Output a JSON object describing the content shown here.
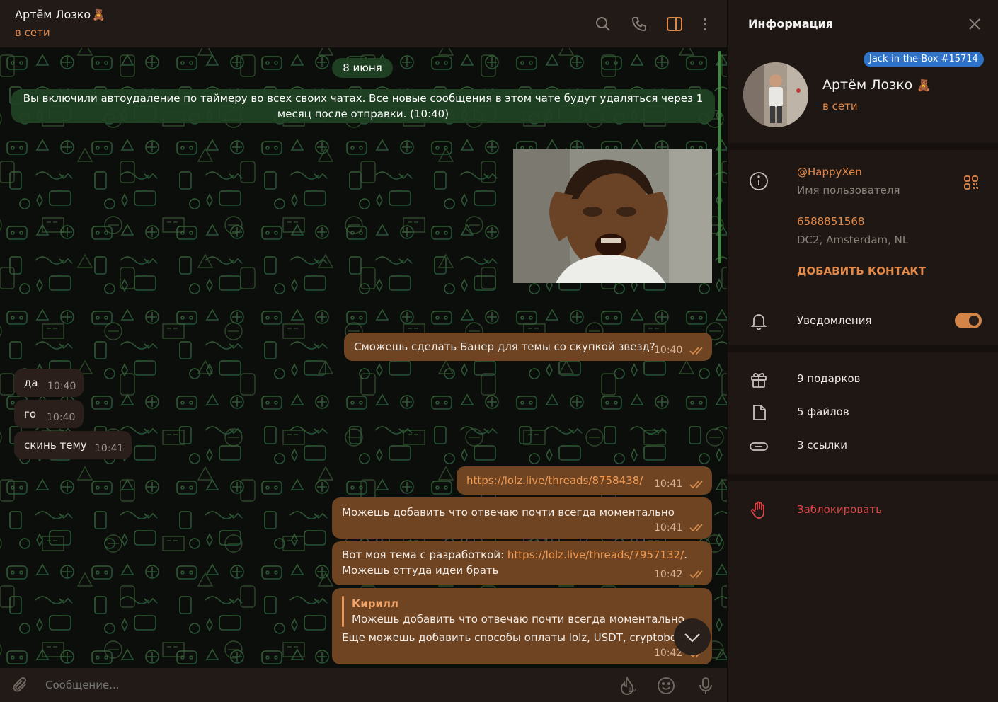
{
  "header": {
    "name": "Артём Лозко",
    "name_emoji": "🧸",
    "status": "в сети",
    "icons": [
      "search-icon",
      "phone-icon",
      "sidebar-toggle-icon",
      "more-icon"
    ]
  },
  "chat": {
    "date_pill": "8 июня",
    "service_message": "Вы включили автоудаление по таймеру во всех своих чатах. Все новые сообщения в этом чате будут удаляться через 1 месяц после отправки. (10:40)",
    "messages": [
      {
        "dir": "out",
        "text": "Сможешь сделать Банер для темы со скупкой звезд?",
        "time": "10:40"
      },
      {
        "dir": "in",
        "text": "да",
        "time": "10:40"
      },
      {
        "dir": "in",
        "text": "го",
        "time": "10:40"
      },
      {
        "dir": "in",
        "text": "скинь тему",
        "time": "10:41"
      },
      {
        "dir": "out",
        "text": "https://lolz.live/threads/8758438/",
        "time": "10:41"
      },
      {
        "dir": "out",
        "text": "Можешь добавить что отвечаю почти всегда моментально",
        "time": "10:41"
      },
      {
        "dir": "out",
        "text_prefix": "Вот моя тема с разработкой: ",
        "link": "https://lolz.live/threads/7957132/",
        "text_suffix": ".",
        "line2": "Можешь оттуда идеи брать",
        "time": "10:42"
      },
      {
        "dir": "out",
        "reply_author": "Кирилл",
        "reply_text": "Можешь добавить что отвечаю почти всегда моментально",
        "text": "Еще можешь добавить способы оплаты lolz, USDT, cryptobot",
        "time": "10:42"
      }
    ]
  },
  "composer": {
    "placeholder": "Сообщение...",
    "timer_label": "1м",
    "icons": [
      "attach-icon",
      "timer-icon",
      "emoji-icon",
      "microphone-icon"
    ]
  },
  "info": {
    "title": "Информация",
    "badge": "Jack-in-the-Box #15714",
    "name": "Артём Лозко",
    "name_emoji": "🧸",
    "status": "в сети",
    "username": "@HappyXen",
    "username_label": "Имя пользователя",
    "phone": "6588851568",
    "dc": "DC2, Amsterdam, NL",
    "add_contact": "ДОБАВИТЬ КОНТАКТ",
    "notifications": "Уведомления",
    "notifications_on": true,
    "gifts": "9 подарков",
    "files": "5 файлов",
    "links": "3 ссылки",
    "block": "Заблокировать"
  },
  "colors": {
    "accent": "#e2894a",
    "bubble_out": "#6e4423",
    "bubble_in": "#2a1f1a",
    "service_pill": "#214324",
    "danger": "#e0454b",
    "badge": "#2f73c8"
  }
}
